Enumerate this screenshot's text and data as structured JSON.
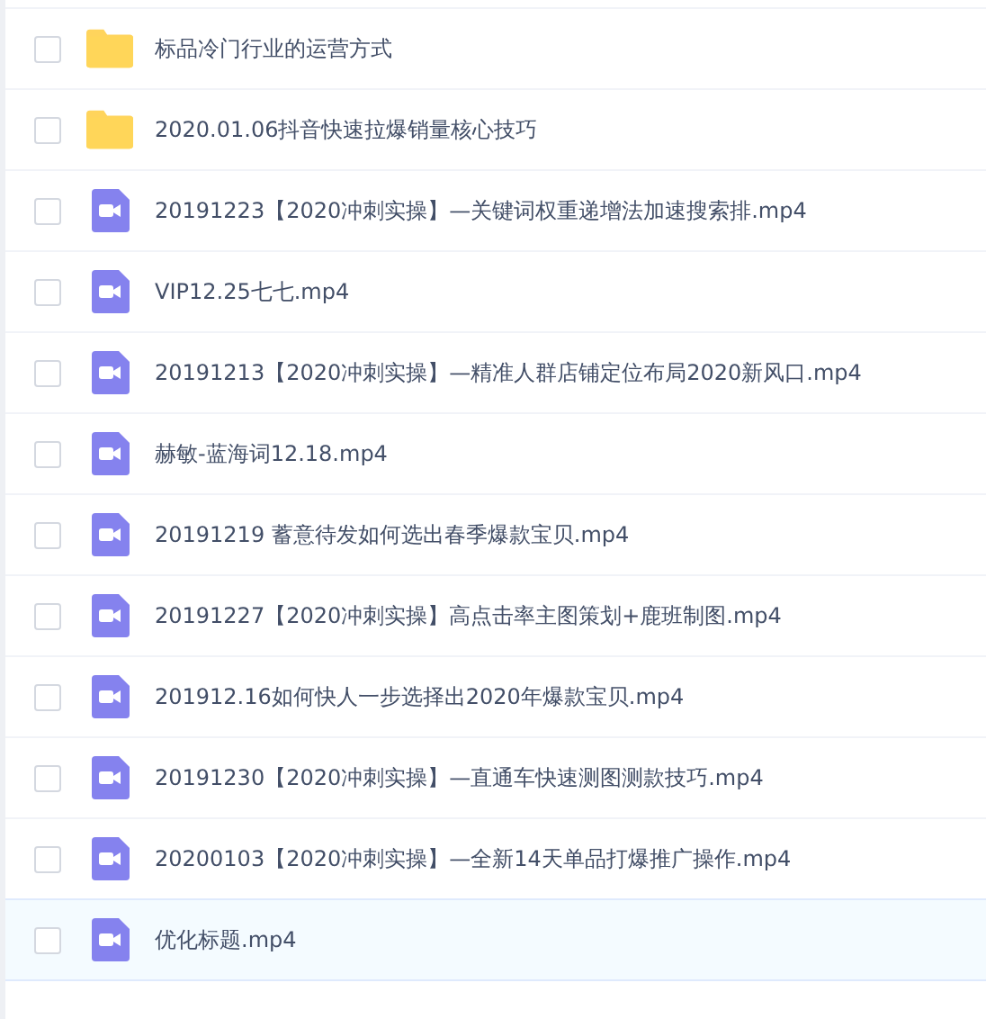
{
  "files": [
    {
      "kind": "folder",
      "name": "标品冷门行业的运营方式",
      "hovered": false
    },
    {
      "kind": "folder",
      "name": "2020.01.06抖音快速拉爆销量核心技巧",
      "hovered": false
    },
    {
      "kind": "video",
      "name": "20191223【2020冲刺实操】—关键词权重递增法加速搜索排.mp4",
      "hovered": false
    },
    {
      "kind": "video",
      "name": "VIP12.25七七.mp4",
      "hovered": false
    },
    {
      "kind": "video",
      "name": "20191213【2020冲刺实操】—精准人群店铺定位布局2020新风口.mp4",
      "hovered": false
    },
    {
      "kind": "video",
      "name": "赫敏-蓝海词12.18.mp4",
      "hovered": false
    },
    {
      "kind": "video",
      "name": "20191219 蓄意待发如何选出春季爆款宝贝.mp4",
      "hovered": false
    },
    {
      "kind": "video",
      "name": "20191227【2020冲刺实操】高点击率主图策划+鹿班制图.mp4",
      "hovered": false
    },
    {
      "kind": "video",
      "name": "201912.16如何快人一步选择出2020年爆款宝贝.mp4",
      "hovered": false
    },
    {
      "kind": "video",
      "name": "20191230【2020冲刺实操】—直通车快速测图测款技巧.mp4",
      "hovered": false
    },
    {
      "kind": "video",
      "name": "20200103【2020冲刺实操】—全新14天单品打爆推广操作.mp4",
      "hovered": false
    },
    {
      "kind": "video",
      "name": "优化标题.mp4",
      "hovered": true
    }
  ]
}
